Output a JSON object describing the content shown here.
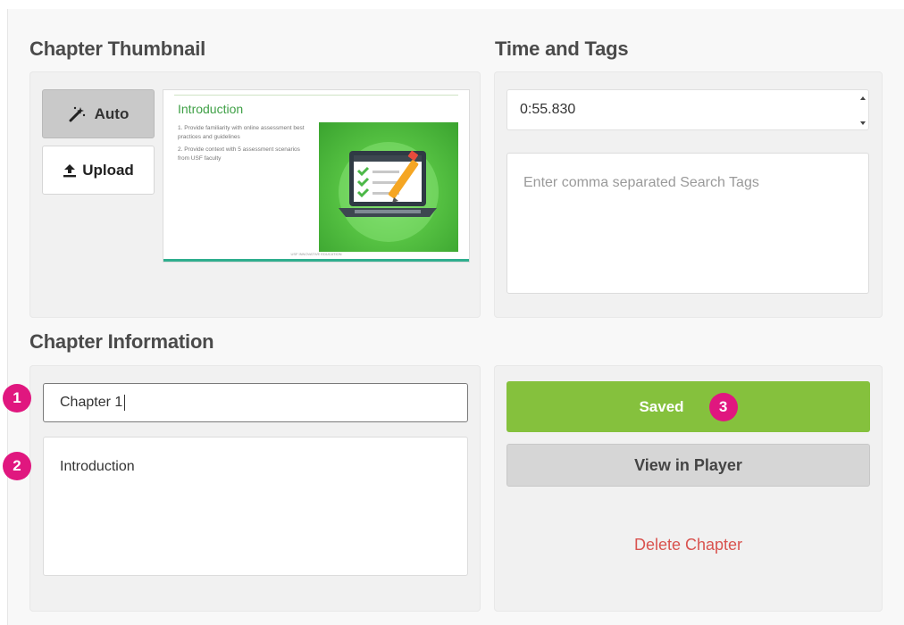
{
  "sections": {
    "thumbnail_title": "Chapter Thumbnail",
    "time_tags_title": "Time and Tags",
    "info_title": "Chapter Information"
  },
  "thumbnail": {
    "auto_label": "Auto",
    "upload_label": "Upload",
    "auto_icon": "magic-wand-icon",
    "upload_icon": "upload-icon",
    "slide": {
      "title": "Introduction",
      "items": [
        "1.  Provide familiarity with online assessment best practices and guidelines",
        "2.  Provide context with 5 assessment scenarios from USF faculty"
      ],
      "footer": "USF INNOVATIVE EDUCATION",
      "image": "laptop-checklist-illustration"
    }
  },
  "time_tags": {
    "time_value": "0:55.830",
    "tags_placeholder": "Enter comma separated Search Tags"
  },
  "chapter_info": {
    "name_value": "Chapter 1",
    "description_value": "Introduction"
  },
  "actions": {
    "saved_label": "Saved",
    "view_label": "View in Player",
    "delete_label": "Delete Chapter"
  },
  "markers": [
    "1",
    "2",
    "3"
  ],
  "colors": {
    "accent_green": "#85c13d",
    "marker_pink": "#e0177f",
    "danger_red": "#d9534f",
    "slide_green": "#3fa046"
  }
}
